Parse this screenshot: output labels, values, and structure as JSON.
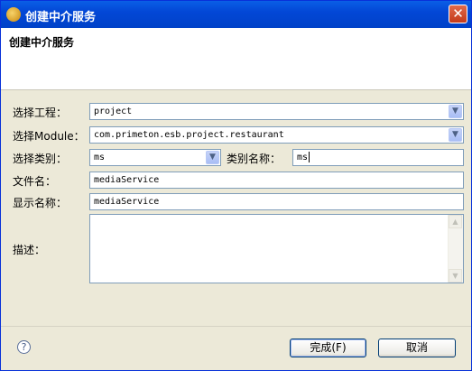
{
  "window": {
    "title": "创建中介服务",
    "close_glyph": "✕"
  },
  "header": {
    "title": "创建中介服务"
  },
  "form": {
    "project": {
      "label": "选择工程：",
      "value": "project"
    },
    "module": {
      "label": "选择Module：",
      "value": "com.primeton.esb.project.restaurant"
    },
    "category": {
      "label": "选择类别：",
      "value": "ms"
    },
    "category_name": {
      "label": "类别名称：",
      "value": "ms"
    },
    "file_name": {
      "label": "文件名：",
      "value": "mediaService"
    },
    "display_name": {
      "label": "显示名称：",
      "value": "mediaService"
    },
    "description": {
      "label": "描述：",
      "value": ""
    }
  },
  "footer": {
    "help_glyph": "?",
    "finish_label": "完成(F)",
    "cancel_label": "取消"
  },
  "icons": {
    "dropdown": "chevron-down-icon",
    "help": "help-icon",
    "close": "close-icon",
    "app": "app-logo-icon"
  }
}
